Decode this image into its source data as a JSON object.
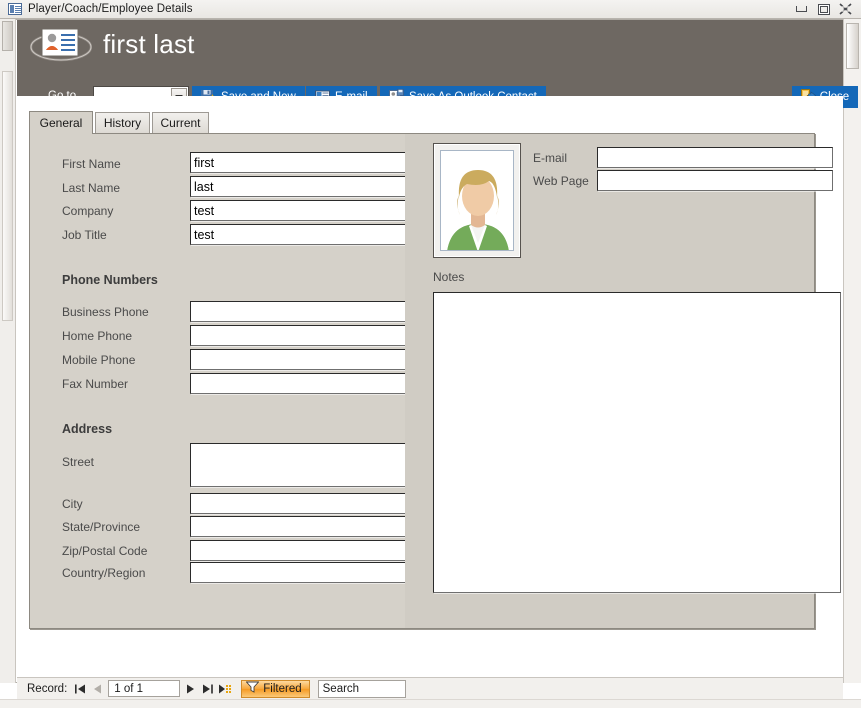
{
  "window": {
    "title": "Player/Coach/Employee Details",
    "icon": "form-view-icon",
    "buttons": {
      "minimize": "minimize-icon",
      "restore": "restore-icon",
      "close": "close-icon"
    }
  },
  "header": {
    "icon": "contact-card-icon",
    "title": "first last",
    "goto_label_prefix": "G",
    "goto_label_rest": "o to",
    "goto_value": "",
    "buttons": [
      {
        "name": "save-and-new",
        "label_prefix": "",
        "label_accel": "S",
        "label_rest": "ave and New",
        "icon": "save-new-icon"
      },
      {
        "name": "email",
        "label_prefix": "",
        "label_accel": "E",
        "label_rest": "-mail",
        "icon": "email-icon"
      },
      {
        "name": "save-as-outlook-contact",
        "label_prefix": "Save As ",
        "label_accel": "O",
        "label_rest": "utlook Contact",
        "icon": "outlook-contact-icon"
      },
      {
        "name": "close",
        "label_prefix": "",
        "label_accel": "C",
        "label_rest": "lose",
        "icon": "exit-door-icon"
      }
    ]
  },
  "tabs": [
    {
      "label": "General",
      "active": true
    },
    {
      "label": "History",
      "active": false
    },
    {
      "label": "Current",
      "active": false
    }
  ],
  "form": {
    "fields": [
      {
        "name": "first-name",
        "label": "First Name",
        "value": "first"
      },
      {
        "name": "last-name",
        "label": "Last Name",
        "value": "last"
      },
      {
        "name": "company",
        "label": "Company",
        "value": "test"
      },
      {
        "name": "job-title",
        "label": "Job Title",
        "value": "test"
      }
    ],
    "phone_section_title": "Phone Numbers",
    "phones": [
      {
        "name": "business-phone",
        "label": "Business Phone",
        "value": ""
      },
      {
        "name": "home-phone",
        "label": "Home Phone",
        "value": ""
      },
      {
        "name": "mobile-phone",
        "label": "Mobile Phone",
        "value": ""
      },
      {
        "name": "fax-number",
        "label": "Fax Number",
        "value": ""
      }
    ],
    "address_section_title": "Address",
    "address": [
      {
        "name": "street",
        "label": "Street",
        "value": ""
      },
      {
        "name": "city",
        "label": "City",
        "value": ""
      },
      {
        "name": "state-province",
        "label": "State/Province",
        "value": ""
      },
      {
        "name": "zip-postal-code",
        "label": "Zip/Postal Code",
        "value": ""
      },
      {
        "name": "country-region",
        "label": "Country/Region",
        "value": ""
      }
    ],
    "photo_alt": "person-placeholder-photo",
    "email": {
      "label": "E-mail",
      "value": ""
    },
    "web_page": {
      "label": "Web Page",
      "value": ""
    },
    "notes_label": "Notes",
    "notes_value": ""
  },
  "navbar": {
    "record_label": "Record:",
    "position_text": "1 of 1",
    "first_icon": "first-record-icon",
    "prev_icon": "previous-record-icon",
    "next_icon": "next-record-icon",
    "last_icon": "last-record-icon",
    "new_icon": "new-record-icon",
    "filtered_label": "Filtered",
    "filter_icon": "funnel-icon",
    "search_placeholder": "Search",
    "search_value": "Search"
  },
  "colors": {
    "header_bg": "#6e6862",
    "button_blue": "#1468b8",
    "panel_bg": "#d5d1c9",
    "panel_bg_right": "#d0ccc4",
    "filter_orange": "#f59a23"
  }
}
